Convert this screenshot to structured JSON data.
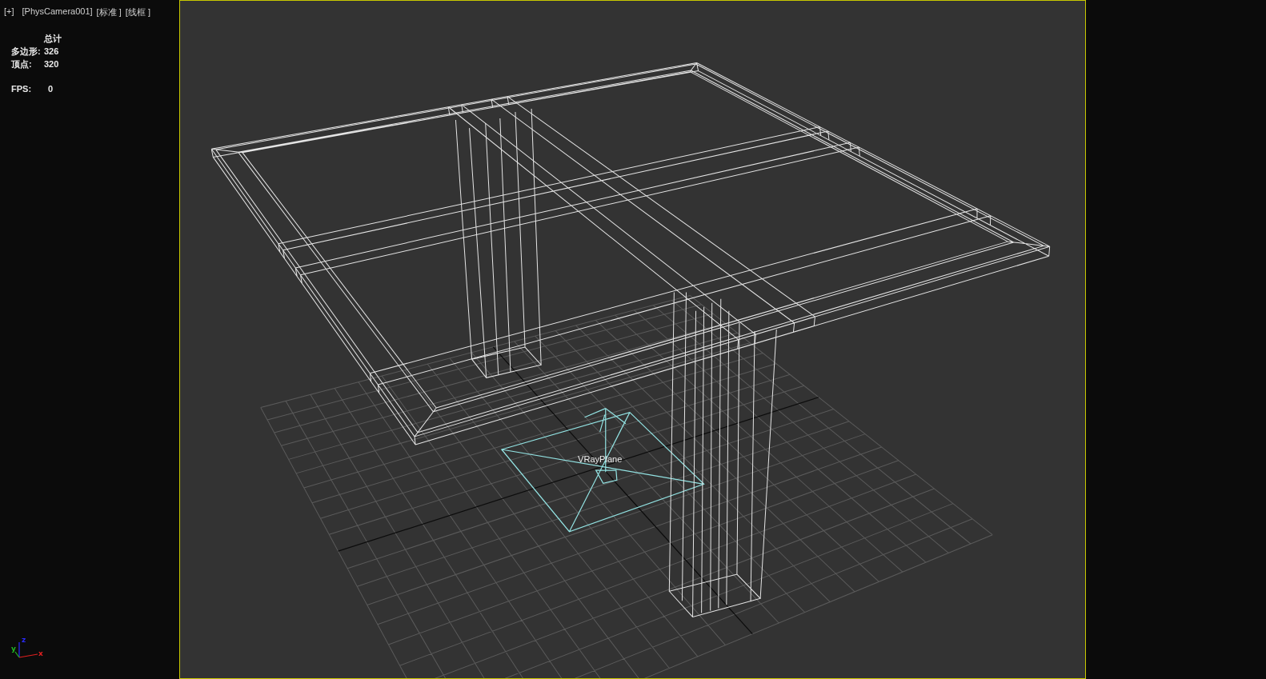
{
  "viewport": {
    "menu_labels": [
      {
        "text": "[+]"
      },
      {
        "text": "[PhysCamera001]"
      },
      {
        "text": "[标准 ]"
      },
      {
        "text": "[线框 ]"
      }
    ],
    "statistics": {
      "header": "总计",
      "rows": [
        {
          "label": "多边形:",
          "value": "326"
        },
        {
          "label": "顶点:",
          "value": "320"
        }
      ],
      "fps": {
        "label": "FPS:",
        "value": "0"
      }
    },
    "safe_frame": {
      "active": true
    },
    "scene": {
      "light_label": "VRayPlane"
    },
    "axis_gizmo": {
      "x": "x",
      "y": "y",
      "z": "z"
    }
  }
}
